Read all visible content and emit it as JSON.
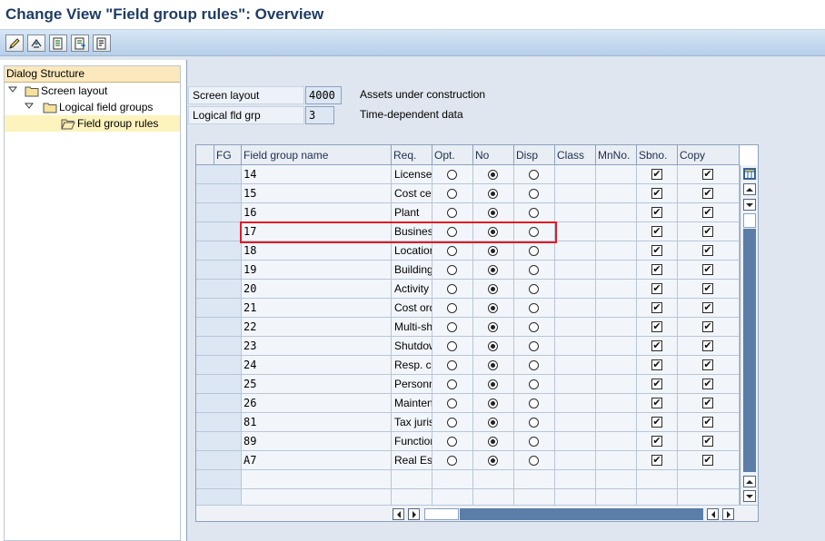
{
  "window": {
    "title": "Change View \"Field group rules\": Overview"
  },
  "toolbar": {
    "buttons": [
      {
        "name": "edit-pencil-icon"
      },
      {
        "name": "toggle-change-display-icon"
      },
      {
        "name": "document-list-icon"
      },
      {
        "name": "document-export-icon"
      },
      {
        "name": "document-print-icon"
      }
    ]
  },
  "dialog_structure": {
    "header": "Dialog Structure",
    "items": [
      {
        "label": "Screen layout",
        "level": 0,
        "expanded": true,
        "selected": false
      },
      {
        "label": "Logical field groups",
        "level": 1,
        "expanded": true,
        "selected": false
      },
      {
        "label": "Field group rules",
        "level": 2,
        "expanded": false,
        "selected": true
      }
    ]
  },
  "header_fields": {
    "screen_layout": {
      "label": "Screen layout",
      "value": "4000",
      "description": "Assets under construction"
    },
    "logical_fld_grp": {
      "label": "Logical fld grp",
      "value": "3",
      "description": "Time-dependent data"
    }
  },
  "table": {
    "columns": [
      "FG",
      "Field group name",
      "Req.",
      "Opt.",
      "No",
      "Disp",
      "Class",
      "MnNo.",
      "Sbno.",
      "Copy"
    ],
    "rows": [
      {
        "fg": "14",
        "name": "License plate number",
        "rule": "opt",
        "mnno": true,
        "sbno": true,
        "copy": false
      },
      {
        "fg": "15",
        "name": "Cost center",
        "rule": "opt",
        "mnno": true,
        "sbno": true,
        "copy": false
      },
      {
        "fg": "16",
        "name": "Plant",
        "rule": "opt",
        "mnno": true,
        "sbno": true,
        "copy": false
      },
      {
        "fg": "17",
        "name": "Business area",
        "rule": "opt",
        "mnno": true,
        "sbno": true,
        "copy": false,
        "highlighted": true
      },
      {
        "fg": "18",
        "name": "Location",
        "rule": "opt",
        "mnno": true,
        "sbno": true,
        "copy": false
      },
      {
        "fg": "19",
        "name": "Building/Room No.",
        "rule": "opt",
        "mnno": true,
        "sbno": true,
        "copy": false
      },
      {
        "fg": "20",
        "name": "Activity type",
        "rule": "opt",
        "mnno": true,
        "sbno": true,
        "copy": false
      },
      {
        "fg": "21",
        "name": "Cost order",
        "rule": "opt",
        "mnno": true,
        "sbno": true,
        "copy": false
      },
      {
        "fg": "22",
        "name": "Multi-shift factor",
        "rule": "opt",
        "mnno": true,
        "sbno": true,
        "copy": false
      },
      {
        "fg": "23",
        "name": "Shutdown",
        "rule": "opt",
        "mnno": true,
        "sbno": true,
        "copy": false
      },
      {
        "fg": "24",
        "name": "Resp. cost center",
        "rule": "opt",
        "mnno": true,
        "sbno": true,
        "copy": false
      },
      {
        "fg": "25",
        "name": "Personnel number HR",
        "rule": "opt",
        "mnno": true,
        "sbno": true,
        "copy": false
      },
      {
        "fg": "26",
        "name": "Maintenance order",
        "rule": "opt",
        "mnno": true,
        "sbno": true,
        "copy": false
      },
      {
        "fg": "81",
        "name": "Tax jurisdict. code",
        "rule": "opt",
        "mnno": true,
        "sbno": true,
        "copy": false
      },
      {
        "fg": "89",
        "name": "Functional Area",
        "rule": "opt",
        "mnno": true,
        "sbno": true,
        "copy": false
      },
      {
        "fg": "A7",
        "name": "Real Estate Object",
        "rule": "opt",
        "mnno": true,
        "sbno": true,
        "copy": false
      }
    ],
    "empty_rows": 2,
    "focused_cell": {
      "row": 0,
      "column": "Req."
    }
  },
  "colors": {
    "title_text": "#1f3c64",
    "highlight_border": "#e31b23",
    "dialog_header_bg": "#fbe8bd",
    "selected_tree_bg": "#fdf3bd"
  }
}
